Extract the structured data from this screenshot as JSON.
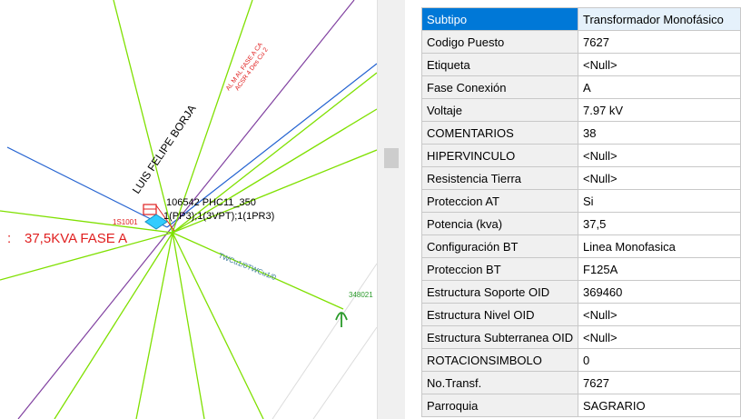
{
  "map": {
    "street_label": "LUIS FELIPE BORJA",
    "line_label_1": "AL M AL FASE A CA",
    "line_label_2": "ACSR 4 Des Cu 2",
    "node_id_label": "106542   PHC11_350",
    "node_config_label": "1(PP3);1(3VPT);1(1PR3)",
    "transformer_code_label": "1S1001",
    "capacity_label": "37,5KVA  FASE A",
    "cable_label": "TWCu1/0TWCu1/0",
    "id_label_right": "348021",
    "colors": {
      "feeder": "#7fe000",
      "street": "#2060d0",
      "boundary": "#8040a0",
      "red_label": "#e02020",
      "symbol": "#2a9a2a",
      "transformer_marker": "#33ccff"
    },
    "icons": [
      "transformer-icon",
      "meter-symbol-icon"
    ]
  },
  "attributes": [
    {
      "field": "Subtipo",
      "value": "Transformador Monofásico"
    },
    {
      "field": "Codigo Puesto",
      "value": "7627"
    },
    {
      "field": "Etiqueta",
      "value": "<Null>"
    },
    {
      "field": "Fase Conexión",
      "value": "A"
    },
    {
      "field": "Voltaje",
      "value": "7.97 kV"
    },
    {
      "field": "COMENTARIOS",
      "value": "38"
    },
    {
      "field": "HIPERVINCULO",
      "value": "<Null>"
    },
    {
      "field": "Resistencia Tierra",
      "value": "<Null>"
    },
    {
      "field": "Proteccion AT",
      "value": "Si"
    },
    {
      "field": "Potencia (kva)",
      "value": "37,5"
    },
    {
      "field": "Configuración BT",
      "value": "Linea Monofasica"
    },
    {
      "field": "Proteccion BT",
      "value": "F125A"
    },
    {
      "field": "Estructura Soporte OID",
      "value": "369460"
    },
    {
      "field": "Estructura Nivel OID",
      "value": "<Null>"
    },
    {
      "field": "Estructura Subterranea OID",
      "value": "<Null>"
    },
    {
      "field": "ROTACIONSIMBOLO",
      "value": "0"
    },
    {
      "field": "No.Transf.",
      "value": "7627"
    },
    {
      "field": "Parroquia",
      "value": "SAGRARIO"
    }
  ]
}
